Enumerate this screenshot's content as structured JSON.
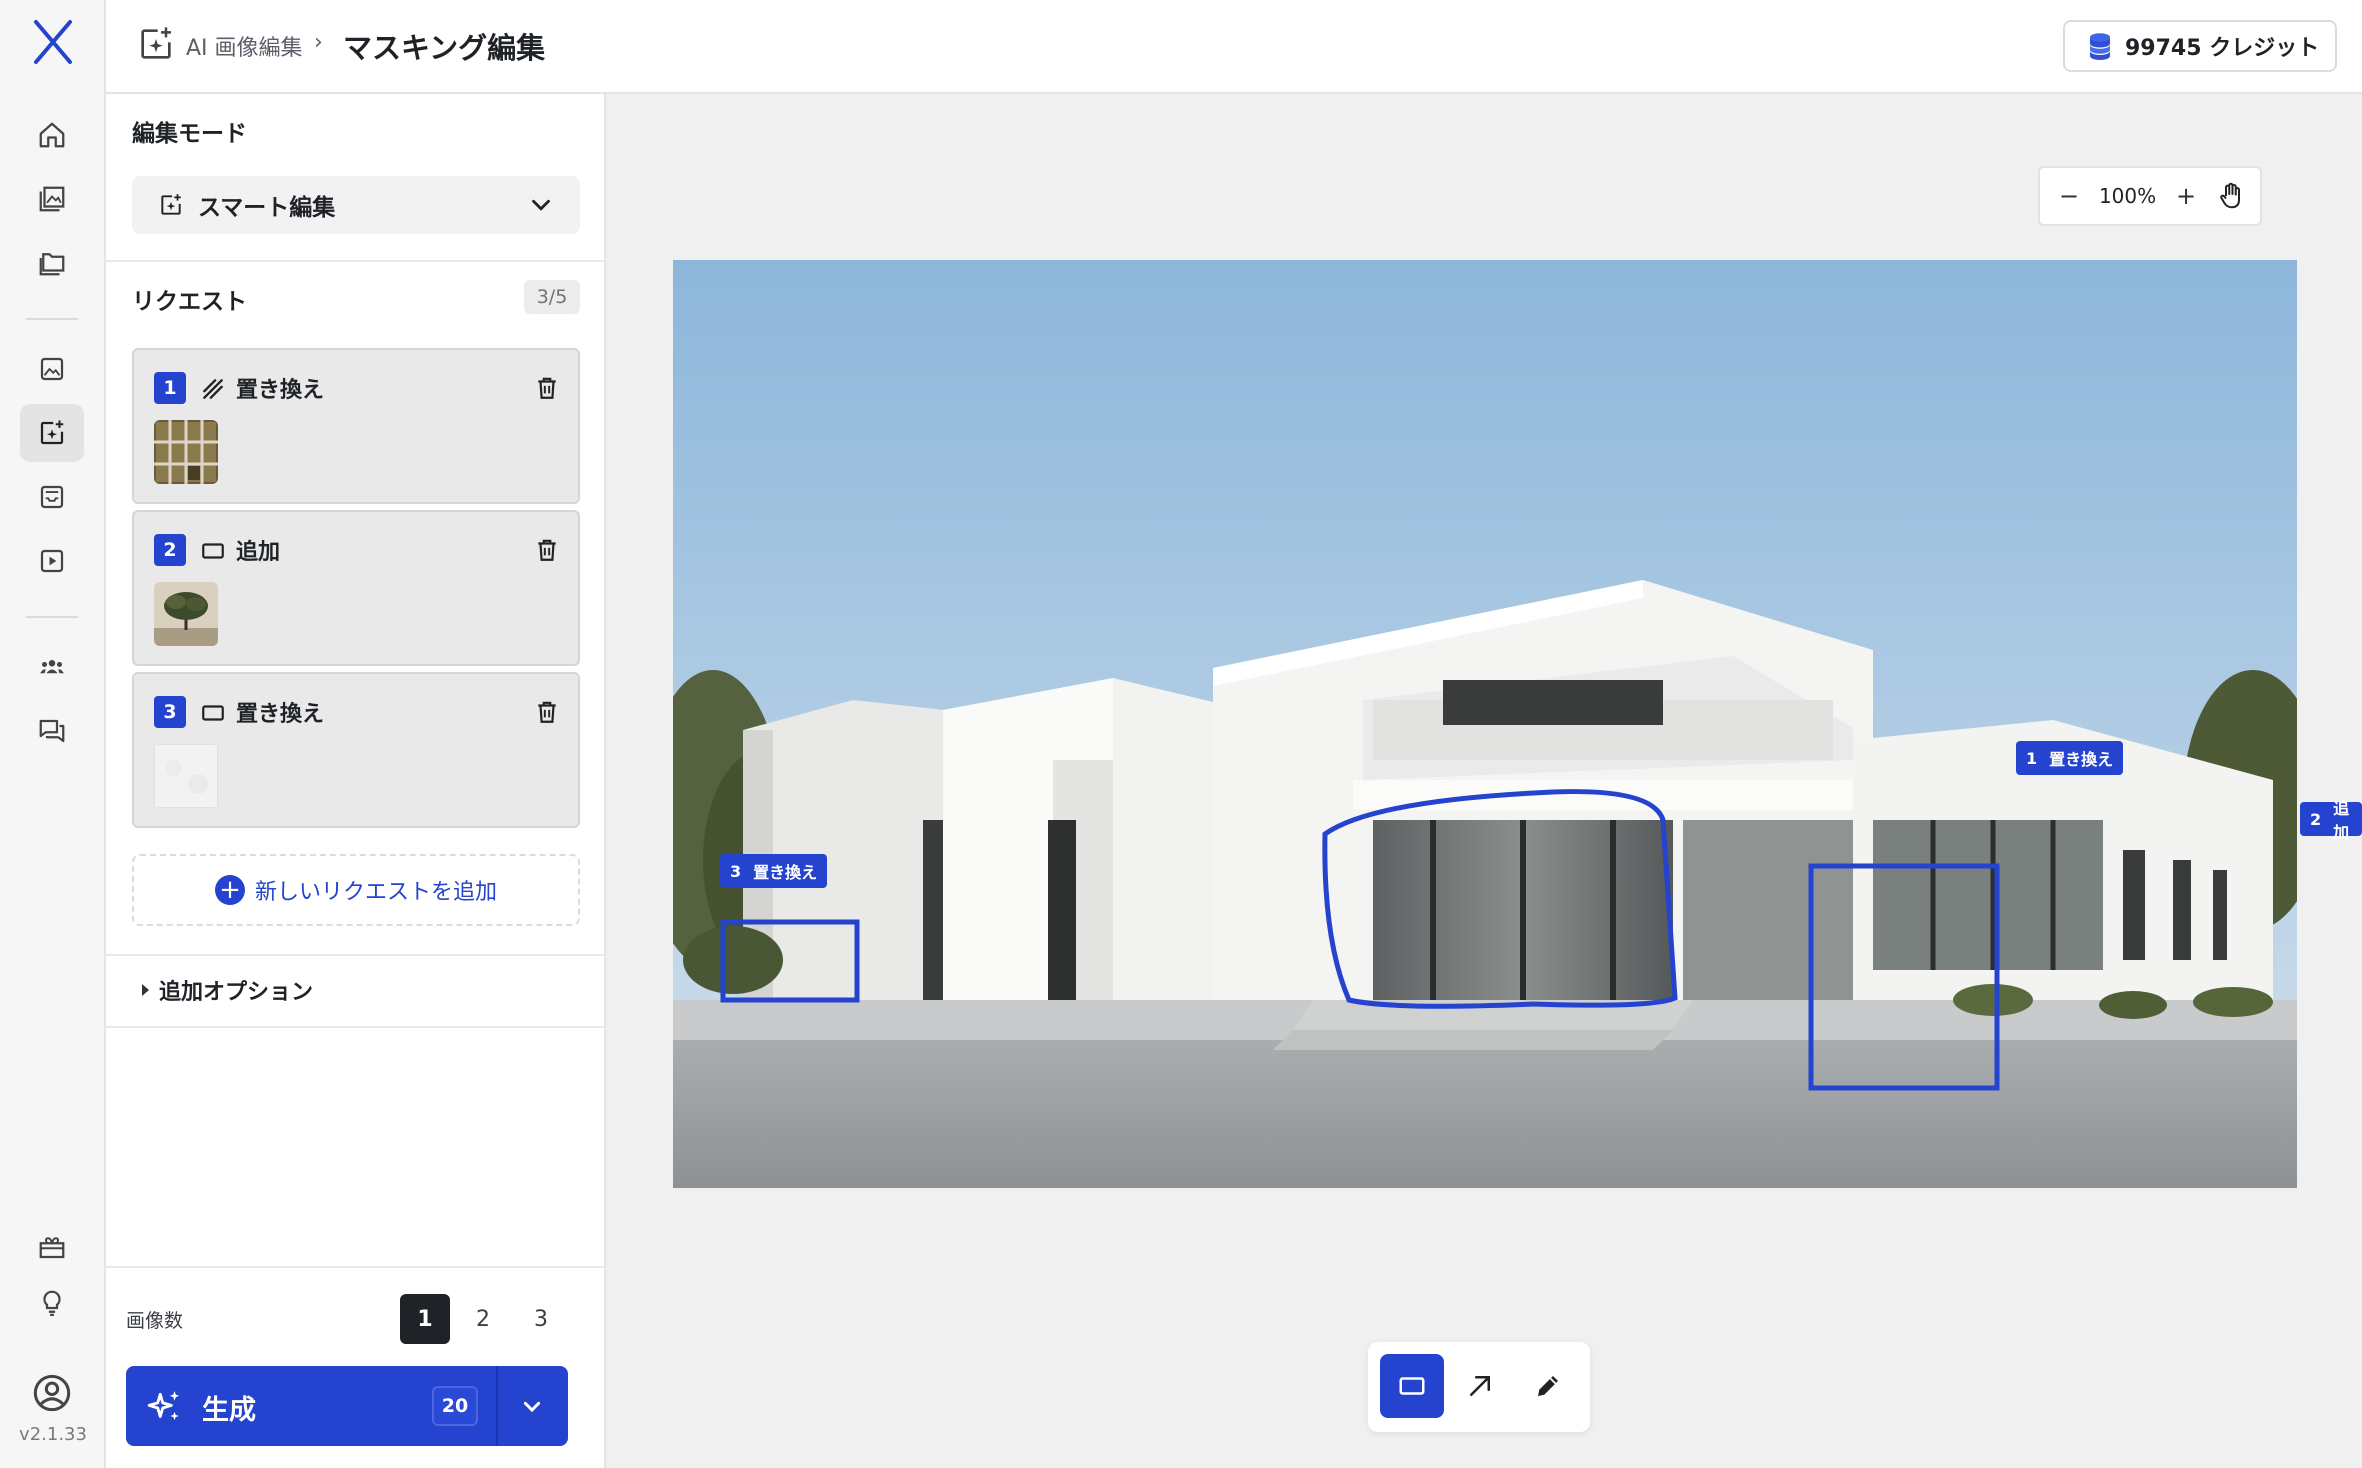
{
  "app": {
    "logo": "X",
    "version": "v2.1.33",
    "accent": "#2443cf",
    "rail_icons": [
      "home-icon",
      "gallery-icon",
      "folder-icon",
      "image-icon",
      "ai-edit-icon",
      "inbox-icon",
      "video-icon",
      "team-icon",
      "chat-icon",
      "gift-icon",
      "lightbulb-icon",
      "account-icon"
    ]
  },
  "topbar": {
    "breadcrumb_parent": "AI 画像編集",
    "breadcrumb_sep": "›",
    "breadcrumb_current": "マスキング編集",
    "credits": "99745 クレジット"
  },
  "panel": {
    "mode_title": "編集モード",
    "mode_value": "スマート編集",
    "requests_title": "リクエスト",
    "requests_count": "3/5",
    "requests": [
      {
        "num": "1",
        "type_icon": "brush-icon",
        "label": "置き換え",
        "thumb": "windows-texture"
      },
      {
        "num": "2",
        "type_icon": "rectangle-icon",
        "label": "追加",
        "thumb": "tree"
      },
      {
        "num": "3",
        "type_icon": "rectangle-icon",
        "label": "置き換え",
        "thumb": "white-texture"
      }
    ],
    "add_request": "新しいリクエストを追加",
    "more_options": "追加オプション",
    "image_count_label": "画像数",
    "image_counts": [
      "1",
      "2",
      "3"
    ],
    "image_count_selected": "1",
    "generate_label": "生成",
    "generate_cost": "20"
  },
  "canvas": {
    "zoom_out": "−",
    "zoom_level": "100%",
    "zoom_in": "+",
    "annotations": [
      {
        "num": "1",
        "label": "置き換え"
      },
      {
        "num": "2",
        "label": "追加"
      },
      {
        "num": "3",
        "label": "置き換え"
      }
    ],
    "tools": [
      "rectangle-tool",
      "arrow-tool",
      "pencil-tool"
    ],
    "selected_tool": "rectangle-tool"
  }
}
